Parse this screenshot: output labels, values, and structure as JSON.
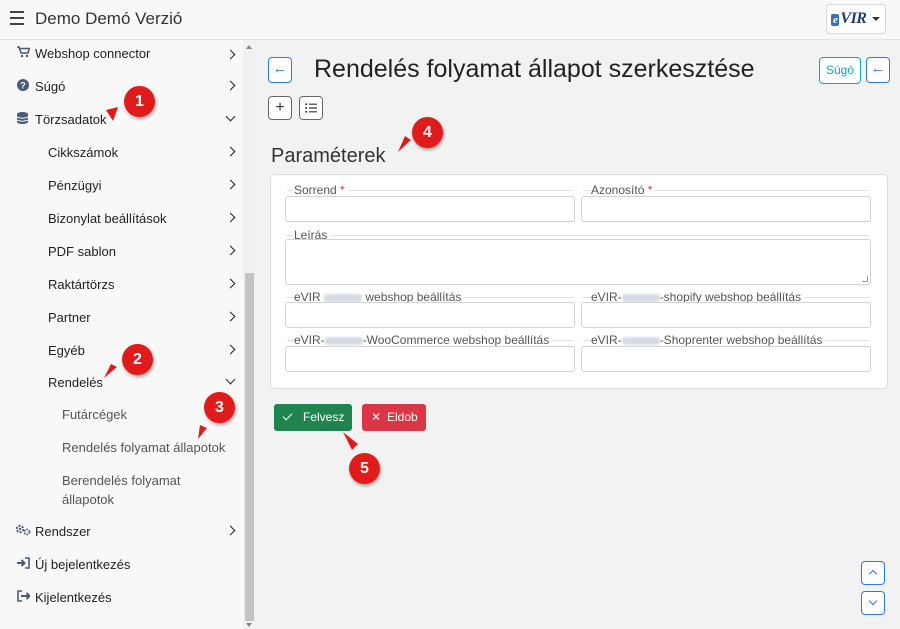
{
  "app": {
    "title": "Demo Demó Verzió"
  },
  "logo": {
    "text": "VIR",
    "e": "e"
  },
  "sidebar": {
    "items": [
      {
        "label": "Webshop connector",
        "icon": "cart-icon"
      },
      {
        "label": "Súgó",
        "icon": "help-circle-icon"
      },
      {
        "label": "Törzsadatok",
        "icon": "database-icon"
      },
      {
        "label": "Cikkszámok"
      },
      {
        "label": "Pénzügyi"
      },
      {
        "label": "Bizonylat beállítások"
      },
      {
        "label": "PDF sablon"
      },
      {
        "label": "Raktártörzs"
      },
      {
        "label": "Partner"
      },
      {
        "label": "Egyéb"
      },
      {
        "label": "Rendelés"
      },
      {
        "label": "Futárcégek"
      },
      {
        "label": "Rendelés folyamat állapotok"
      },
      {
        "label": "Berendelés folyamat",
        "label2": "állapotok"
      },
      {
        "label": "Rendszer",
        "icon": "gears-icon"
      },
      {
        "label": "Új bejelentkezés",
        "icon": "sign-in-icon"
      },
      {
        "label": "Kijelentkezés",
        "icon": "sign-out-icon"
      }
    ]
  },
  "page": {
    "title": "Rendelés folyamat állapot szerkesztése",
    "help_label": "Súgó",
    "section_title": "Paraméterek"
  },
  "form": {
    "sorrend_label": "Sorrend",
    "azonosito_label": "Azonosító",
    "leiras_label": "Leírás",
    "webshop_pre": "eVIR",
    "webshop_post": "webshop beállítás",
    "shopify_pre": "eVIR-",
    "shopify_post": "-shopify webshop beállítás",
    "woo_pre": "eVIR-",
    "woo_post": "-WooCommerce webshop beállítás",
    "shoprenter_pre": "eVIR-",
    "shoprenter_post": "-Shoprenter webshop beállítás",
    "required_mark": "*"
  },
  "buttons": {
    "save": "Felvesz",
    "cancel": "Eldob"
  },
  "badges": [
    "1",
    "2",
    "3",
    "4",
    "5"
  ],
  "colors": {
    "primary": "#2c7be5",
    "success": "#208451",
    "danger": "#dc3545",
    "info": "#17a2b8",
    "badge": "#e01b1b"
  }
}
